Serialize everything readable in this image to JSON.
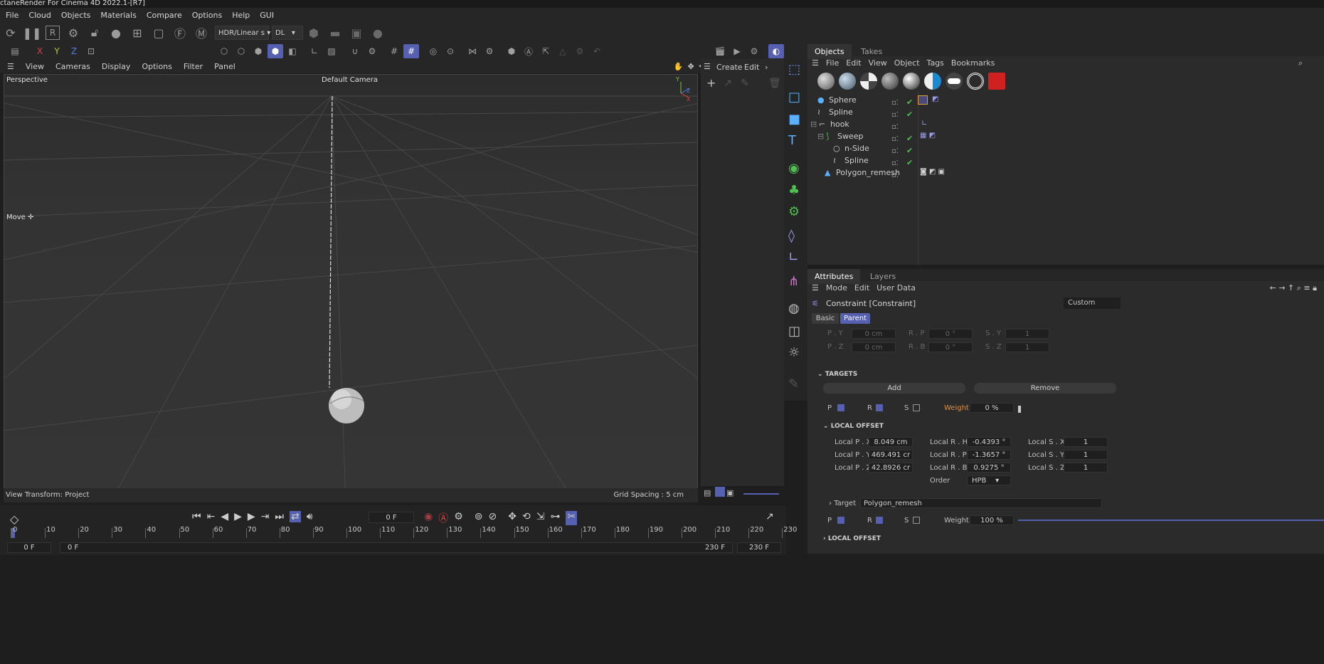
{
  "window": {
    "title": "ctaneRender For Cinema 4D 2022.1-[R7]"
  },
  "menu": [
    "File",
    "Cloud",
    "Objects",
    "Materials",
    "Compare",
    "Options",
    "Help",
    "GUI"
  ],
  "toolbar": {
    "render_mode": "HDR/Linear s",
    "kernel": "DL"
  },
  "viewport_menu": [
    "View",
    "Cameras",
    "Display",
    "Options",
    "Filter",
    "Panel"
  ],
  "viewport": {
    "label": "Perspective",
    "camera": "Default Camera",
    "tool": "Move",
    "view_transform": "View Transform: Project",
    "grid_spacing": "Grid Spacing : 5 cm"
  },
  "create_panel": {
    "create": "Create",
    "edit": "Edit"
  },
  "objects_panel": {
    "tabs": [
      "Objects",
      "Takes"
    ],
    "menu": [
      "File",
      "Edit",
      "View",
      "Object",
      "Tags",
      "Bookmarks"
    ],
    "items": [
      "Sphere",
      "Spline",
      "hook",
      "Sweep",
      "n-Side",
      "Spline",
      "Polygon_remesh"
    ]
  },
  "attributes_panel": {
    "tabs": [
      "Attributes",
      "Layers"
    ],
    "menu": [
      "Mode",
      "Edit",
      "User Data"
    ],
    "object": "Constraint [Constraint]",
    "preset": "Custom",
    "subtabs": [
      "Basic",
      "Parent"
    ],
    "rows_top": [
      {
        "a": "P . Y",
        "av": "0 cm",
        "b": "R . P",
        "bv": "0 °",
        "c": "S . Y",
        "cv": "1"
      },
      {
        "a": "P . Z",
        "av": "0 cm",
        "b": "R . B",
        "bv": "0 °",
        "c": "S . Z",
        "cv": "1"
      }
    ],
    "targets_label": "TARGETS",
    "add_label": "Add",
    "remove_label": "Remove",
    "prs_labels": [
      "P",
      "R",
      "S"
    ],
    "weight_label": "Weight",
    "weight_value": "0 %",
    "local_offset_label": "LOCAL OFFSET",
    "local_rows": [
      {
        "a": "Local P . X",
        "av": "8.049 cm",
        "b": "Local R . H",
        "bv": "-0.4393 °",
        "c": "Local S . X",
        "cv": "1"
      },
      {
        "a": "Local P . Y",
        "av": "469.491 cr",
        "b": "Local R . P",
        "bv": "-1.3657 °",
        "c": "Local S . Y",
        "cv": "1"
      },
      {
        "a": "Local P . Z",
        "av": "42.8926 cr",
        "b": "Local R . B",
        "bv": "0.9275 °",
        "c": "Local S . Z",
        "cv": "1"
      }
    ],
    "order_label": "Order",
    "order_value": "HPB",
    "target_label": "Target",
    "target_value": "Polygon_remesh",
    "weight2_value": "100 %",
    "local_offset2_label": "LOCAL OFFSET"
  },
  "timeline": {
    "ticks": [
      "0",
      "10",
      "20",
      "30",
      "40",
      "50",
      "60",
      "70",
      "80",
      "90",
      "100",
      "110",
      "120",
      "130",
      "140",
      "150",
      "160",
      "170",
      "180",
      "190",
      "200",
      "210",
      "220",
      "230"
    ],
    "current_frame": "0 F",
    "start": "0 F",
    "start2": "0 F",
    "end": "230 F",
    "end2": "230 F"
  }
}
